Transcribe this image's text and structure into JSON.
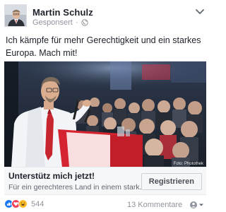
{
  "post": {
    "author": "Martin Schulz",
    "sponsored_label": "Gesponsert",
    "text": "Ich kämpfe für mehr Gerechtigkeit und ein starkes Europa. Mach mit!",
    "photo_credit": "Foto: Photothek"
  },
  "cta": {
    "title": "Unterstütz mich jetzt!",
    "description": "Für ein gerechteres Land in einem stark...",
    "button_label": "Registrieren"
  },
  "footer": {
    "reaction_count": "544",
    "comments_label": "13 Kommentare"
  },
  "colors": {
    "like": "#1877f2",
    "love": "#f33e58",
    "haha": "#f7b928"
  },
  "icons": [
    "globe-icon",
    "chevron-down-icon",
    "like-reaction-icon",
    "love-reaction-icon",
    "haha-reaction-icon",
    "dropdown-icon"
  ]
}
